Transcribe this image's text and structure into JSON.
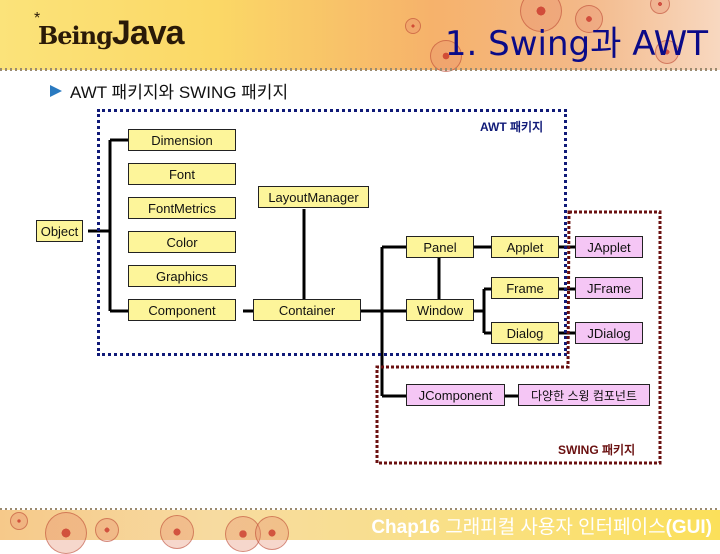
{
  "header": {
    "logo_star": "*",
    "logo_being": "Being",
    "logo_java": "Java",
    "title": "1. Swing과 AWT"
  },
  "subtitle": {
    "icon": "arrow-right-icon",
    "text": "AWT 패키지와 SWING 패키지"
  },
  "diagram": {
    "regions": {
      "awt_label": "AWT 패키지",
      "swing_label": "SWING 패키지",
      "awt_color": "#101a78",
      "swing_color": "#6a1010"
    },
    "colors": {
      "awt_box": "#fdf59a",
      "swing_box": "#f5c6f5"
    },
    "nodes": {
      "object": "Object",
      "dimension": "Dimension",
      "font": "Font",
      "fontmetrics": "FontMetrics",
      "color": "Color",
      "graphics": "Graphics",
      "component": "Component",
      "layoutmanager": "LayoutManager",
      "container": "Container",
      "panel": "Panel",
      "window": "Window",
      "applet": "Applet",
      "frame": "Frame",
      "dialog": "Dialog",
      "japplet": "JApplet",
      "jframe": "JFrame",
      "jdialog": "JDialog",
      "jcomponent": "JComponent",
      "swing_components": "다양한 스윙 컴포넌트"
    },
    "edges": [
      [
        "Object",
        "Dimension"
      ],
      [
        "Object",
        "Font"
      ],
      [
        "Object",
        "FontMetrics"
      ],
      [
        "Object",
        "Color"
      ],
      [
        "Object",
        "Graphics"
      ],
      [
        "Object",
        "Component"
      ],
      [
        "Component",
        "Container"
      ],
      [
        "LayoutManager",
        "Container"
      ],
      [
        "Container",
        "Panel"
      ],
      [
        "Container",
        "Window"
      ],
      [
        "Container",
        "JComponent"
      ],
      [
        "Panel",
        "Applet"
      ],
      [
        "Panel",
        "Window"
      ],
      [
        "Window",
        "Frame"
      ],
      [
        "Window",
        "Dialog"
      ],
      [
        "Applet",
        "JApplet"
      ],
      [
        "Frame",
        "JFrame"
      ],
      [
        "Dialog",
        "JDialog"
      ],
      [
        "JComponent",
        "다양한 스윙 컴포넌트"
      ]
    ]
  },
  "footer": {
    "chapter": "Chap16",
    "title_ko": " 그래피컬 사용자 인터페이스",
    "title_en": "(GUI)"
  }
}
